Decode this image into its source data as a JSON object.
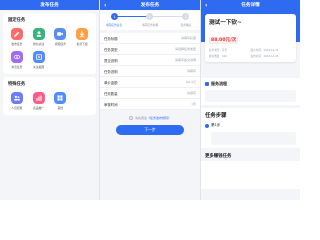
{
  "panel1": {
    "title": "发布任务",
    "sections": [
      {
        "title": "固定任务",
        "items": [
          {
            "label": "发布任务",
            "icon": "edit-icon",
            "color": "#ff6b6b"
          },
          {
            "label": "微信关注",
            "icon": "follow-icon",
            "color": "#36b37e"
          },
          {
            "label": "视频任务",
            "icon": "video-icon",
            "color": "#5b8def"
          },
          {
            "label": "投票下载",
            "icon": "download-icon",
            "color": "#ff9f43"
          },
          {
            "label": "浏览任务",
            "icon": "browse-icon",
            "color": "#a06cf0"
          },
          {
            "label": "关注截图",
            "icon": "screenshot-icon",
            "color": "#4f8cff"
          }
        ]
      },
      {
        "title": "特殊任务",
        "items": [
          {
            "label": "人员招募",
            "icon": "people-icon",
            "color": "#6c7cff"
          },
          {
            "label": "商品推广",
            "icon": "chart-icon",
            "color": "#ff5c8a"
          },
          {
            "label": "其他",
            "icon": "grid-icon",
            "color": "#4f8cff"
          }
        ]
      }
    ]
  },
  "panel2": {
    "title": "发布任务",
    "steps": [
      "填写任务信息",
      "填写任务步骤",
      "任务确认"
    ],
    "rows": [
      {
        "label": "任务标题",
        "value": "请填写标题"
      },
      {
        "label": "任务类型",
        "value": "请选择任务类型"
      },
      {
        "label": "提交说明",
        "value": "请填写提交说明"
      },
      {
        "label": "任务说明",
        "value": "请填写"
      },
      {
        "label": "单价金额",
        "value": "≥0.3元"
      },
      {
        "label": "任务数量",
        "value": "请填写"
      },
      {
        "label": "审核时间",
        "value": "1天"
      }
    ],
    "agree_prefix": "请先阅读",
    "agree_link": "《任务发布规则》",
    "next_label": "下一步"
  },
  "panel3": {
    "title": "任务详情",
    "task_title": "测试一下钦~",
    "price": "88.00元/次",
    "meta": [
      "任务类型：任务",
      "截止时间：2023-12-31",
      "剩余数量：100",
      "发布时间：2023-12-01"
    ],
    "section_service": "服务流程",
    "steps_title": "任务步骤",
    "step1": "第1步",
    "more_title": "更多赚钱任务"
  },
  "colors": {
    "accent": "#2f6bf0",
    "price": "#e53935"
  }
}
